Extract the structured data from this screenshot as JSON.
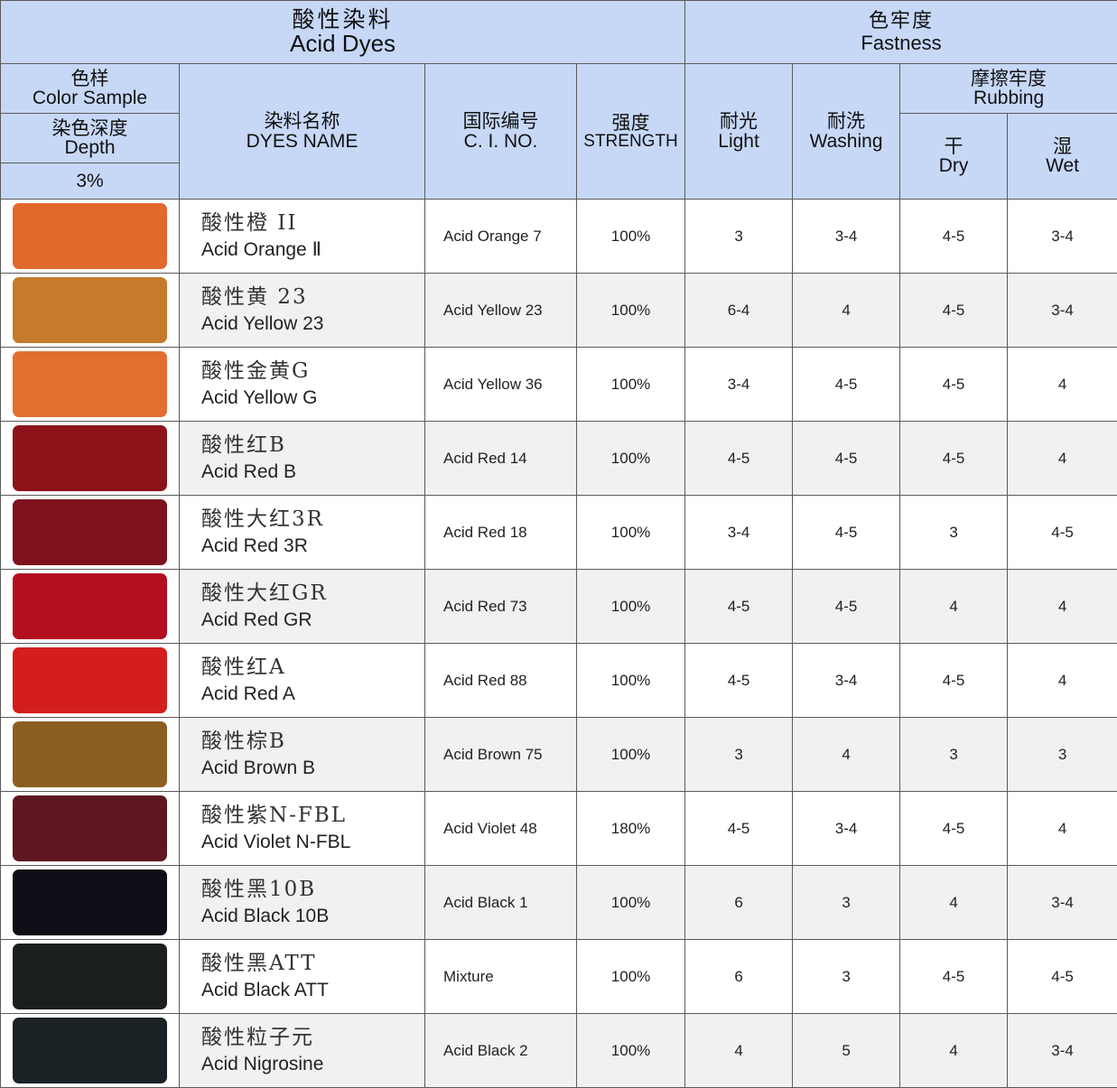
{
  "header": {
    "acid_dyes_zh": "酸性染料",
    "acid_dyes_en": "Acid Dyes",
    "fastness_zh": "色牢度",
    "fastness_en": "Fastness",
    "color_sample_zh": "色样",
    "color_sample_en": "Color Sample",
    "depth_zh": "染色深度",
    "depth_en": "Depth",
    "depth_value": "3%",
    "dyes_name_zh": "染料名称",
    "dyes_name_en": "DYES NAME",
    "ci_zh": "国际编号",
    "ci_en": "C. I. NO.",
    "strength_zh": "强度",
    "strength_en": "STRENGTH",
    "light_zh": "耐光",
    "light_en": "Light",
    "washing_zh": "耐洗",
    "washing_en": "Washing",
    "rubbing_zh": "摩擦牢度",
    "rubbing_en": "Rubbing",
    "dry_zh": "干",
    "dry_en": "Dry",
    "wet_zh": "湿",
    "wet_en": "Wet"
  },
  "rows": [
    {
      "color": "#e2692c",
      "name_zh": "酸性橙 II",
      "name_en": "Acid Orange Ⅱ",
      "ci": "Acid Orange 7",
      "strength": "100%",
      "light": "3",
      "washing": "3-4",
      "dry": "4-5",
      "wet": "3-4"
    },
    {
      "color": "#c67a2c",
      "name_zh": "酸性黄 23",
      "name_en": "Acid Yellow 23",
      "ci": "Acid Yellow 23",
      "strength": "100%",
      "light": "6-4",
      "washing": "4",
      "dry": "4-5",
      "wet": "3-4"
    },
    {
      "color": "#e26f30",
      "name_zh": "酸性金黄G",
      "name_en": "Acid Yellow G",
      "ci": "Acid Yellow 36",
      "strength": "100%",
      "light": "3-4",
      "washing": "4-5",
      "dry": "4-5",
      "wet": "4"
    },
    {
      "color": "#8c1319",
      "name_zh": "酸性红B",
      "name_en": "Acid Red B",
      "ci": "Acid Red 14",
      "strength": "100%",
      "light": "4-5",
      "washing": "4-5",
      "dry": "4-5",
      "wet": "4"
    },
    {
      "color": "#7d121c",
      "name_zh": "酸性大红3R",
      "name_en": "Acid Red 3R",
      "ci": "Acid Red 18",
      "strength": "100%",
      "light": "3-4",
      "washing": "4-5",
      "dry": "3",
      "wet": "4-5"
    },
    {
      "color": "#b30f1f",
      "name_zh": "酸性大红GR",
      "name_en": "Acid Red GR",
      "ci": "Acid Red 73",
      "strength": "100%",
      "light": "4-5",
      "washing": "4-5",
      "dry": "4",
      "wet": "4"
    },
    {
      "color": "#d41e1e",
      "name_zh": "酸性红A",
      "name_en": "Acid Red A",
      "ci": "Acid Red 88",
      "strength": "100%",
      "light": "4-5",
      "washing": "3-4",
      "dry": "4-5",
      "wet": "4"
    },
    {
      "color": "#8c5e21",
      "name_zh": "酸性棕B",
      "name_en": "Acid Brown B",
      "ci": "Acid Brown 75",
      "strength": "100%",
      "light": "3",
      "washing": "4",
      "dry": "3",
      "wet": "3"
    },
    {
      "color": "#5e1720",
      "name_zh": "酸性紫N-FBL",
      "name_en": "Acid Violet N-FBL",
      "ci": "Acid Violet 48",
      "strength": "180%",
      "light": "4-5",
      "washing": "3-4",
      "dry": "4-5",
      "wet": "4"
    },
    {
      "color": "#0f0f17",
      "name_zh": "酸性黑10B",
      "name_en": "Acid Black 10B",
      "ci": "Acid Black 1",
      "strength": "100%",
      "light": "6",
      "washing": "3",
      "dry": "4",
      "wet": "3-4"
    },
    {
      "color": "#1c1f1f",
      "name_zh": "酸性黑ATT",
      "name_en": "Acid Black ATT",
      "ci": "Mixture",
      "strength": "100%",
      "light": "6",
      "washing": "3",
      "dry": "4-5",
      "wet": "4-5"
    },
    {
      "color": "#1b2226",
      "name_zh": "酸性粒子元",
      "name_en": "Acid Nigrosine",
      "ci": "Acid Black 2",
      "strength": "100%",
      "light": "4",
      "washing": "5",
      "dry": "4",
      "wet": "3-4"
    }
  ]
}
